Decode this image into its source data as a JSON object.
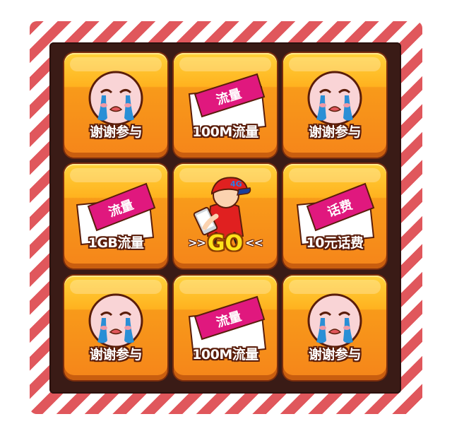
{
  "prize_grid": {
    "tiles": [
      {
        "label": "谢谢参与",
        "icon": "crying-face-icon"
      },
      {
        "label": "100M流量",
        "icon": "data-ticket-icon",
        "ticket_text": "流量"
      },
      {
        "label": "谢谢参与",
        "icon": "crying-face-icon"
      },
      {
        "label": "1GB流量",
        "icon": "data-ticket-icon",
        "ticket_text": "流量"
      },
      {
        "label": "GO",
        "icon": "4g-mascot-icon",
        "arrow_left": ">>",
        "arrow_right": "<<",
        "mascot_text": "4G"
      },
      {
        "label": "10元话费",
        "icon": "credit-ticket-icon",
        "ticket_text": "话费"
      },
      {
        "label": "谢谢参与",
        "icon": "crying-face-icon"
      },
      {
        "label": "100M流量",
        "icon": "data-ticket-icon",
        "ticket_text": "流量"
      },
      {
        "label": "谢谢参与",
        "icon": "crying-face-icon"
      }
    ]
  },
  "colors": {
    "frame_stripe": "#e0575c",
    "board": "#3a1b16",
    "tile_top": "#ffd23a",
    "tile_bottom": "#f5851a",
    "ticket_band": "#e0187e",
    "go_text": "#ffe11a"
  }
}
